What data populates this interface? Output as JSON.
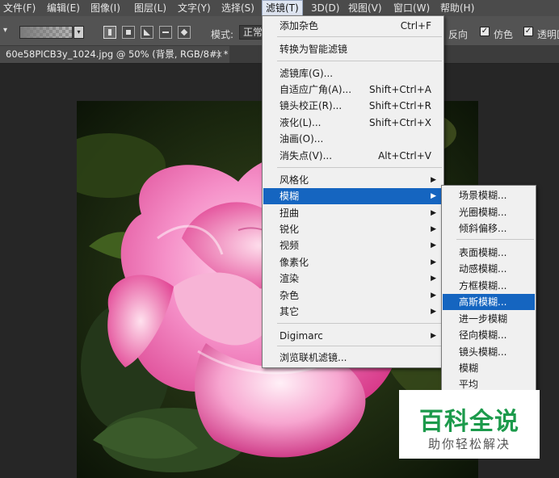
{
  "menubar": {
    "items": [
      "文件(F)",
      "编辑(E)",
      "图像(I)",
      "图层(L)",
      "文字(Y)",
      "选择(S)",
      "滤镜(T)",
      "3D(D)",
      "视图(V)",
      "窗口(W)",
      "帮助(H)"
    ],
    "active": "滤镜(T)"
  },
  "options": {
    "mode_label": "模式:",
    "mode_value": "正常",
    "reverse_label": "反向",
    "dither_label": "仿色",
    "transparency_label": "透明区"
  },
  "document": {
    "tab_title": "60e58PICB3y_1024.jpg @ 50% (背景, RGB/8#) *",
    "close_glyph": "×"
  },
  "filter_menu": {
    "items": [
      {
        "label": "添加杂色",
        "shortcut": "Ctrl+F"
      },
      {
        "label": "转换为智能滤镜"
      },
      {
        "label": "滤镜库(G)..."
      },
      {
        "label": "自适应广角(A)...",
        "shortcut": "Shift+Ctrl+A"
      },
      {
        "label": "镜头校正(R)...",
        "shortcut": "Shift+Ctrl+R"
      },
      {
        "label": "液化(L)...",
        "shortcut": "Shift+Ctrl+X"
      },
      {
        "label": "油画(O)..."
      },
      {
        "label": "消失点(V)...",
        "shortcut": "Alt+Ctrl+V"
      },
      {
        "label": "风格化",
        "submenu": true
      },
      {
        "label": "模糊",
        "submenu": true,
        "highlighted": true
      },
      {
        "label": "扭曲",
        "submenu": true
      },
      {
        "label": "锐化",
        "submenu": true
      },
      {
        "label": "视频",
        "submenu": true
      },
      {
        "label": "像素化",
        "submenu": true
      },
      {
        "label": "渲染",
        "submenu": true
      },
      {
        "label": "杂色",
        "submenu": true
      },
      {
        "label": "其它",
        "submenu": true
      },
      {
        "label": "Digimarc",
        "submenu": true
      },
      {
        "label": "浏览联机滤镜..."
      }
    ]
  },
  "blur_submenu": {
    "items": [
      {
        "label": "场景模糊..."
      },
      {
        "label": "光圈模糊..."
      },
      {
        "label": "倾斜偏移..."
      },
      {
        "label": "表面模糊..."
      },
      {
        "label": "动感模糊..."
      },
      {
        "label": "方框模糊..."
      },
      {
        "label": "高斯模糊...",
        "highlighted": true
      },
      {
        "label": "进一步模糊"
      },
      {
        "label": "径向模糊..."
      },
      {
        "label": "镜头模糊..."
      },
      {
        "label": "模糊"
      },
      {
        "label": "平均"
      }
    ]
  },
  "watermark": {
    "title": "百科全说",
    "subtitle": "助你轻松解决"
  },
  "colors": {
    "highlight": "#1565c0",
    "menubar": "#4b4b4b",
    "workspace": "#262626",
    "watermark_green": "#1c9a4b"
  }
}
